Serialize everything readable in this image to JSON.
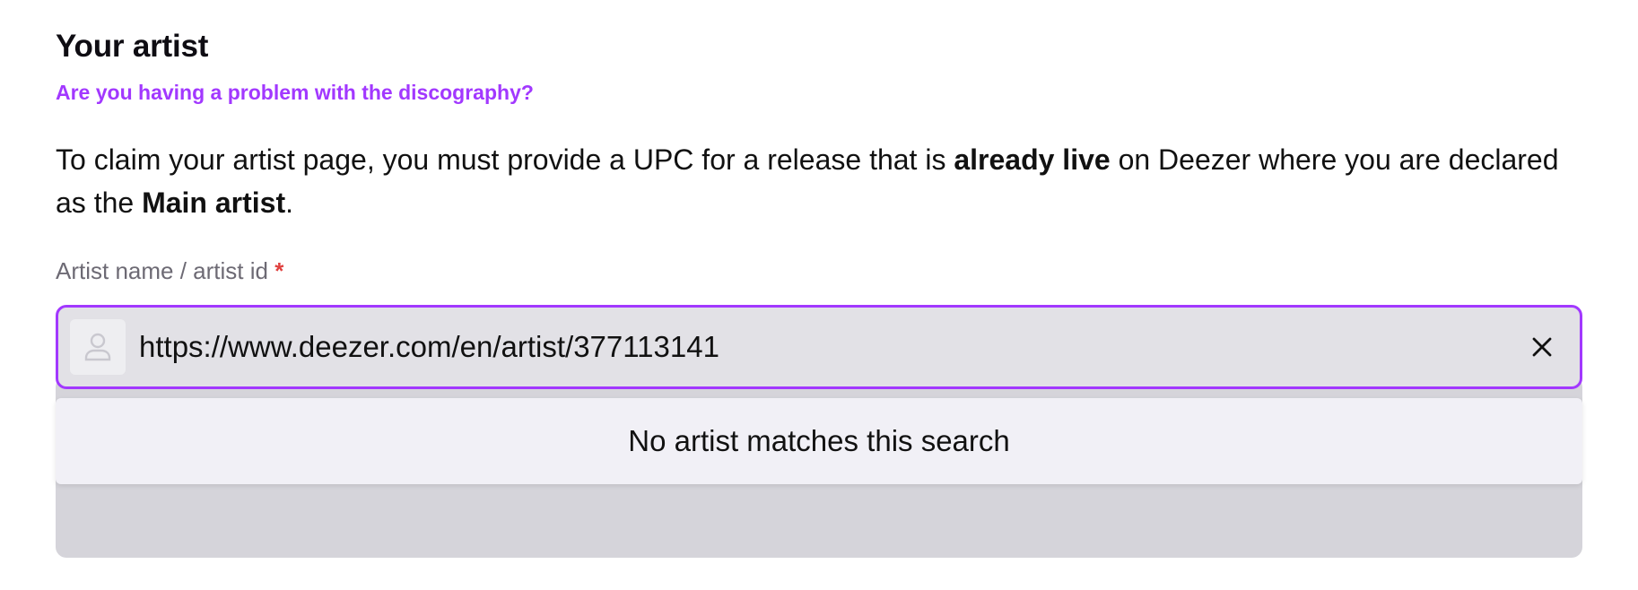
{
  "section": {
    "title": "Your artist",
    "help_link": "Are you having a problem with the discography?",
    "intro": {
      "part1": "To claim your artist page, you must provide a UPC for a release that is ",
      "bold1": "already live",
      "part2": " on Deezer where you are declared as the ",
      "bold2": "Main artist",
      "part3": "."
    }
  },
  "field": {
    "label": "Artist name / artist id ",
    "required_marker": "*",
    "value": "https://www.deezer.com/en/artist/377113141",
    "avatar_icon": "person-icon",
    "clear_icon": "close-icon"
  },
  "results": {
    "empty_message": "No artist matches this search"
  },
  "colors": {
    "accent": "#a238ff",
    "required": "#e0413f",
    "input_bg": "#e2e1e6",
    "dropdown_bg": "#f1f0f6"
  }
}
